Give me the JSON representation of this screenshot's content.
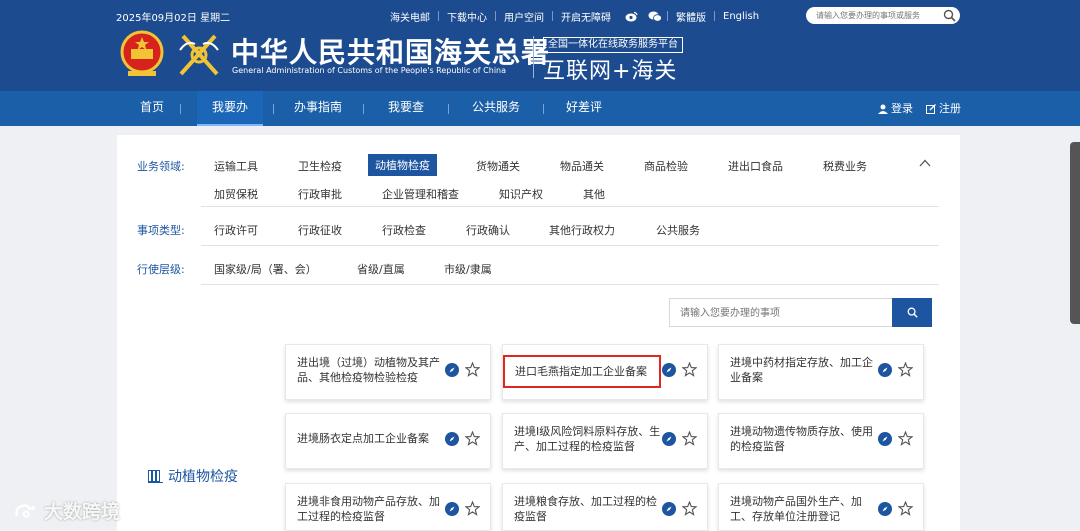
{
  "header": {
    "date": "2025年09月02日 星期二",
    "links": [
      "海关电邮",
      "下载中心",
      "用户空间",
      "开启无障碍"
    ],
    "social_icons": [
      "weibo-icon",
      "wechat-icon"
    ],
    "links_right": [
      "繁體版",
      "English"
    ],
    "search_placeholder": "请输入您要办理的事项或服务",
    "title_cn": "中华人民共和国海关总署",
    "title_en": "General Administration of Customs of the People's Republic of China",
    "platform_box": "全国一体化在线政务服务平台",
    "platform_big": "互联网+海关"
  },
  "nav": {
    "items": [
      "首页",
      "我要办",
      "办事指南",
      "我要查",
      "公共服务",
      "好差评"
    ],
    "active": "我要办",
    "login": "登录",
    "register": "注册"
  },
  "filters": {
    "domain_label": "业务领域:",
    "domain_row1": [
      "运输工具",
      "卫生检疫",
      "动植物检疫",
      "货物通关",
      "物品通关",
      "商品检验",
      "进出口食品",
      "税费业务"
    ],
    "domain_row2": [
      "加贸保税",
      "行政审批",
      "企业管理和稽查",
      "知识产权",
      "其他"
    ],
    "domain_selected": "动植物检疫",
    "type_label": "事项类型:",
    "types": [
      "行政许可",
      "行政征收",
      "行政检查",
      "行政确认",
      "其他行政权力",
      "公共服务"
    ],
    "level_label": "行使层级:",
    "levels": [
      "国家级/局（署、会）",
      "省级/直属",
      "市级/隶属"
    ]
  },
  "search": {
    "placeholder": "请输入您要办理的事项"
  },
  "section_title": "动植物检疫",
  "cards": [
    {
      "text": "进出境（过境）动植物及其产品、其他检疫物检验检疫",
      "highlighted": false
    },
    {
      "text": "进口毛燕指定加工企业备案",
      "highlighted": true
    },
    {
      "text": "进境中药材指定存放、加工企业备案",
      "highlighted": false
    },
    {
      "text": "进境肠衣定点加工企业备案",
      "highlighted": false
    },
    {
      "text": "进境Ⅰ级风险饲料原料存放、生产、加工过程的检疫监督",
      "highlighted": false
    },
    {
      "text": "进境动物遗传物质存放、使用的检疫监督",
      "highlighted": false
    },
    {
      "text": "进境非食用动物产品存放、加工过程的检疫监督",
      "highlighted": false
    },
    {
      "text": "进境粮食存放、加工过程的检疫监督",
      "highlighted": false
    },
    {
      "text": "进境动物产品国外生产、加工、存放单位注册登记",
      "highlighted": false
    }
  ],
  "watermark": "大数跨境",
  "colors": {
    "header_bg": "#1d4b8f",
    "nav_bg": "#1a5fa8",
    "accent": "#1d55a0",
    "highlight_border": "#e0261f"
  }
}
